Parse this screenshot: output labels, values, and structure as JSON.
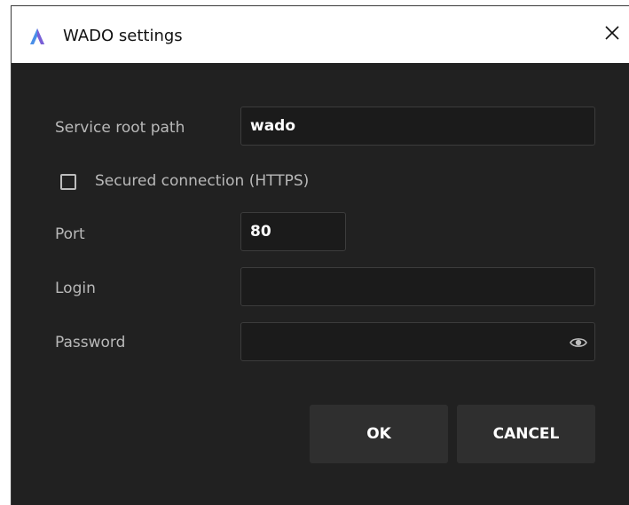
{
  "window": {
    "title": "WADO settings"
  },
  "form": {
    "service_root_path": {
      "label": "Service root path",
      "value": "wado"
    },
    "secured_connection": {
      "label": "Secured connection (HTTPS)",
      "checked": false
    },
    "port": {
      "label": "Port",
      "value": "80"
    },
    "login": {
      "label": "Login",
      "value": ""
    },
    "password": {
      "label": "Password",
      "value": ""
    }
  },
  "buttons": {
    "ok": "OK",
    "cancel": "CANCEL"
  },
  "icons": {
    "app": "app-logo-icon",
    "close": "close-icon",
    "eye": "eye-icon"
  },
  "colors": {
    "accent": "#4a8fe8",
    "background": "#212121",
    "button": "#2f2f2f"
  }
}
